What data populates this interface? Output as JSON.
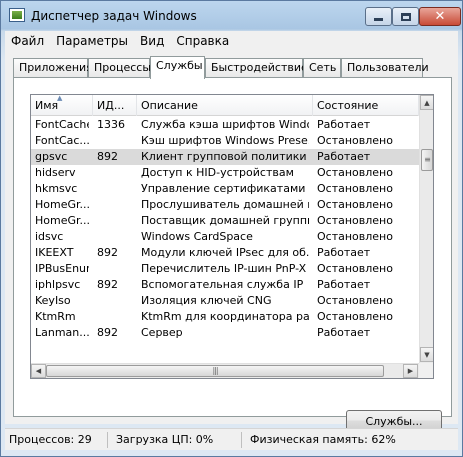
{
  "window": {
    "title": "Диспетчер задач Windows"
  },
  "menu": [
    "Файл",
    "Параметры",
    "Вид",
    "Справка"
  ],
  "tabs": [
    "Приложения",
    "Процессы",
    "Службы",
    "Быстродействие",
    "Сеть",
    "Пользователи"
  ],
  "active_tab": "Службы",
  "columns": [
    "Имя",
    "ИД...",
    "Описание",
    "Состояние"
  ],
  "rows": [
    {
      "name": "FontCache",
      "pid": "1336",
      "desc": "Служба кэша шрифтов Windo...",
      "status": "Работает"
    },
    {
      "name": "FontCac...",
      "pid": "",
      "desc": "Кэш шрифтов Windows Prese...",
      "status": "Остановлено"
    },
    {
      "name": "gpsvc",
      "pid": "892",
      "desc": "Клиент групповой политики",
      "status": "Работает"
    },
    {
      "name": "hidserv",
      "pid": "",
      "desc": "Доступ к HID-устройствам",
      "status": "Остановлено"
    },
    {
      "name": "hkmsvc",
      "pid": "",
      "desc": "Управление сертификатами ...",
      "status": "Остановлено"
    },
    {
      "name": "HomeGr...",
      "pid": "",
      "desc": "Прослушиватель домашней г...",
      "status": "Остановлено"
    },
    {
      "name": "HomeGr...",
      "pid": "",
      "desc": "Поставщик домашней группы",
      "status": "Остановлено"
    },
    {
      "name": "idsvc",
      "pid": "",
      "desc": "Windows CardSpace",
      "status": "Остановлено"
    },
    {
      "name": "IKEEXT",
      "pid": "892",
      "desc": "Модули ключей IPsec для об...",
      "status": "Работает"
    },
    {
      "name": "IPBusEnum",
      "pid": "",
      "desc": "Перечислитель IP-шин PnP-X",
      "status": "Остановлено"
    },
    {
      "name": "iphlpsvc",
      "pid": "892",
      "desc": "Вспомогательная служба IP",
      "status": "Работает"
    },
    {
      "name": "KeyIso",
      "pid": "",
      "desc": "Изоляция ключей CNG",
      "status": "Остановлено"
    },
    {
      "name": "KtmRm",
      "pid": "",
      "desc": "KtmRm для координатора ра...",
      "status": "Остановлено"
    },
    {
      "name": "Lanman...",
      "pid": "892",
      "desc": "Сервер",
      "status": "Работает"
    }
  ],
  "selected_row": 2,
  "services_button": "Службы...",
  "status": {
    "processes": "Процессов: 29",
    "cpu": "Загрузка ЦП: 0%",
    "memory": "Физическая память: 62%"
  }
}
